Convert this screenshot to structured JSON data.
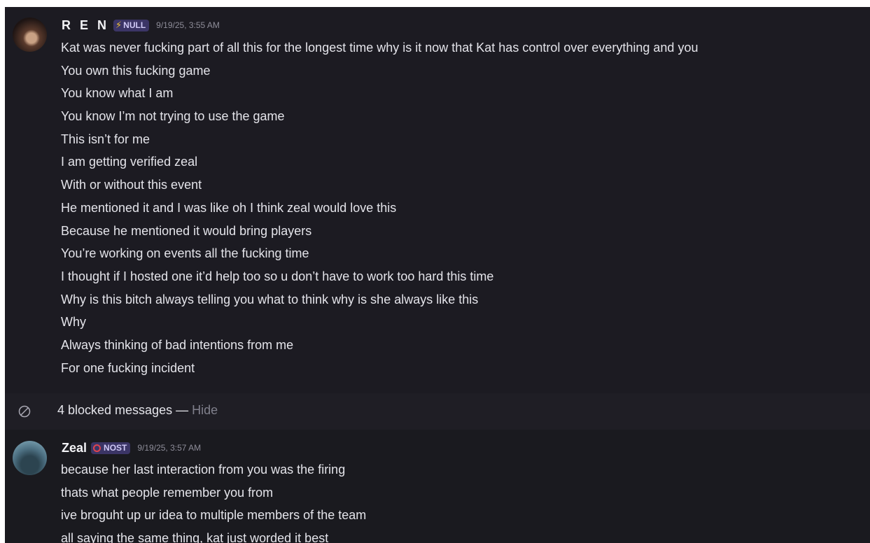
{
  "messages": {
    "ren": {
      "username": "R E N",
      "tag": "NULL",
      "tag_icon": "lightning-bolt-icon",
      "timestamp": "9/19/25, 3:55 AM",
      "lines": [
        "Kat was never fucking part of all this for the longest time why is it now that Kat has control over everything and you",
        "You own this fucking game",
        "You know what I am",
        "You know I’m not trying to use the game",
        "This isn’t for me",
        "I am getting verified zeal",
        "With or without this event",
        "He mentioned it and I was like oh I think zeal would love this",
        "Because he mentioned it would bring players",
        "You’re working on events all the fucking time",
        "I thought if I hosted one it’d help too so u don’t have to work too hard this time",
        "Why is this bitch always telling you what to think why is she always like this",
        "Why",
        "Always thinking of bad intentions from me",
        "For one fucking incident"
      ]
    },
    "blocked": {
      "text": "4 blocked messages — ",
      "hide_label": "Hide",
      "icon": "blocked-icon"
    },
    "zeal": {
      "username": "Zeal",
      "tag": "NOST",
      "tag_icon": "nost-ring-icon",
      "timestamp": "9/19/25, 3:57 AM",
      "lines": [
        "because her last interaction from you was the firing",
        "thats what people remember you from",
        "ive broguht up ur idea to multiple members of the team",
        "all saying the same thing, kat just worded it best"
      ]
    }
  },
  "colors": {
    "background": "#1a1a1f",
    "tag_bg": "#3b3566",
    "timestamp": "#8e8d99",
    "hide_link": "#80808c"
  }
}
